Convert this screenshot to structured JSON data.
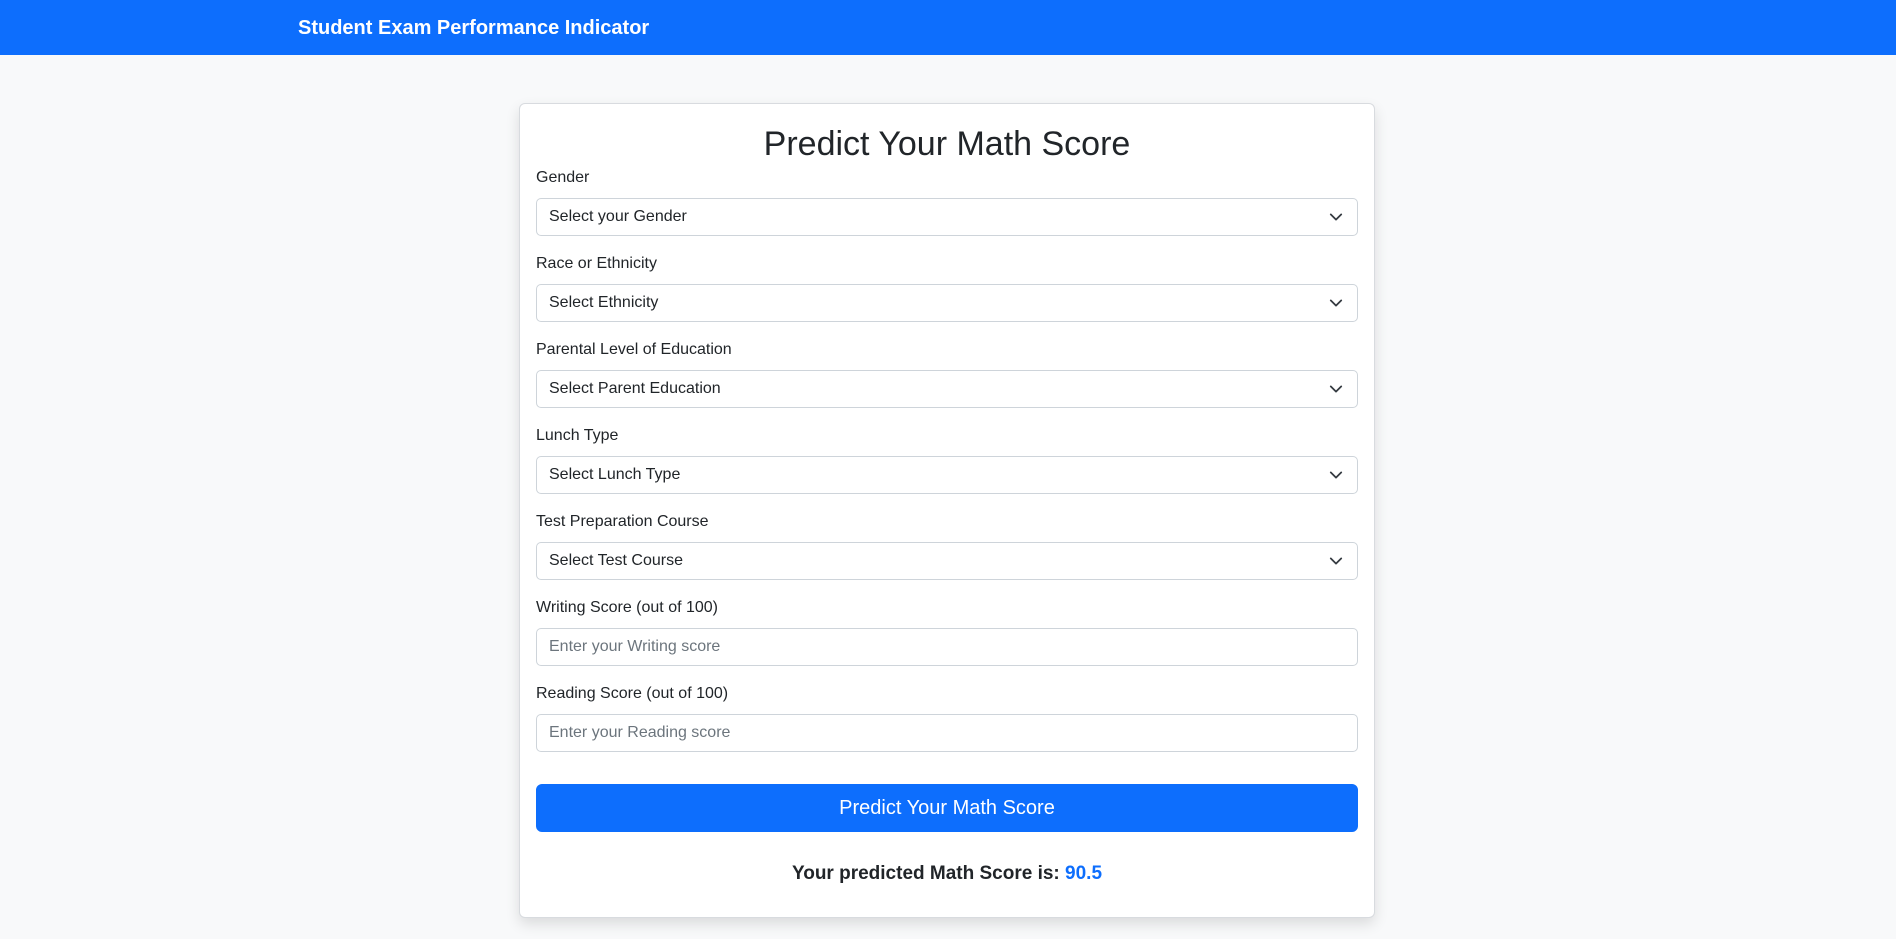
{
  "navbar": {
    "brand": "Student Exam Performance Indicator"
  },
  "form": {
    "title": "Predict Your Math Score",
    "fields": [
      {
        "label": "Gender",
        "type": "select",
        "value": "Select your Gender"
      },
      {
        "label": "Race or Ethnicity",
        "type": "select",
        "value": "Select Ethnicity"
      },
      {
        "label": "Parental Level of Education",
        "type": "select",
        "value": "Select Parent Education"
      },
      {
        "label": "Lunch Type",
        "type": "select",
        "value": "Select Lunch Type"
      },
      {
        "label": "Test Preparation Course",
        "type": "select",
        "value": "Select Test Course"
      },
      {
        "label": "Writing Score (out of 100)",
        "type": "input",
        "placeholder": "Enter your Writing score"
      },
      {
        "label": "Reading Score (out of 100)",
        "type": "input",
        "placeholder": "Enter your Reading score"
      }
    ],
    "submit_label": "Predict Your Math Score",
    "result_prefix": "Your predicted Math Score is:",
    "result_value": "90.5"
  },
  "icons": {
    "select_arrow": "chevron-down-icon"
  },
  "colors": {
    "primary": "#0d6efd",
    "background": "#f8f9fa",
    "card": "#ffffff",
    "text": "#212529",
    "placeholder": "#6c757d"
  }
}
